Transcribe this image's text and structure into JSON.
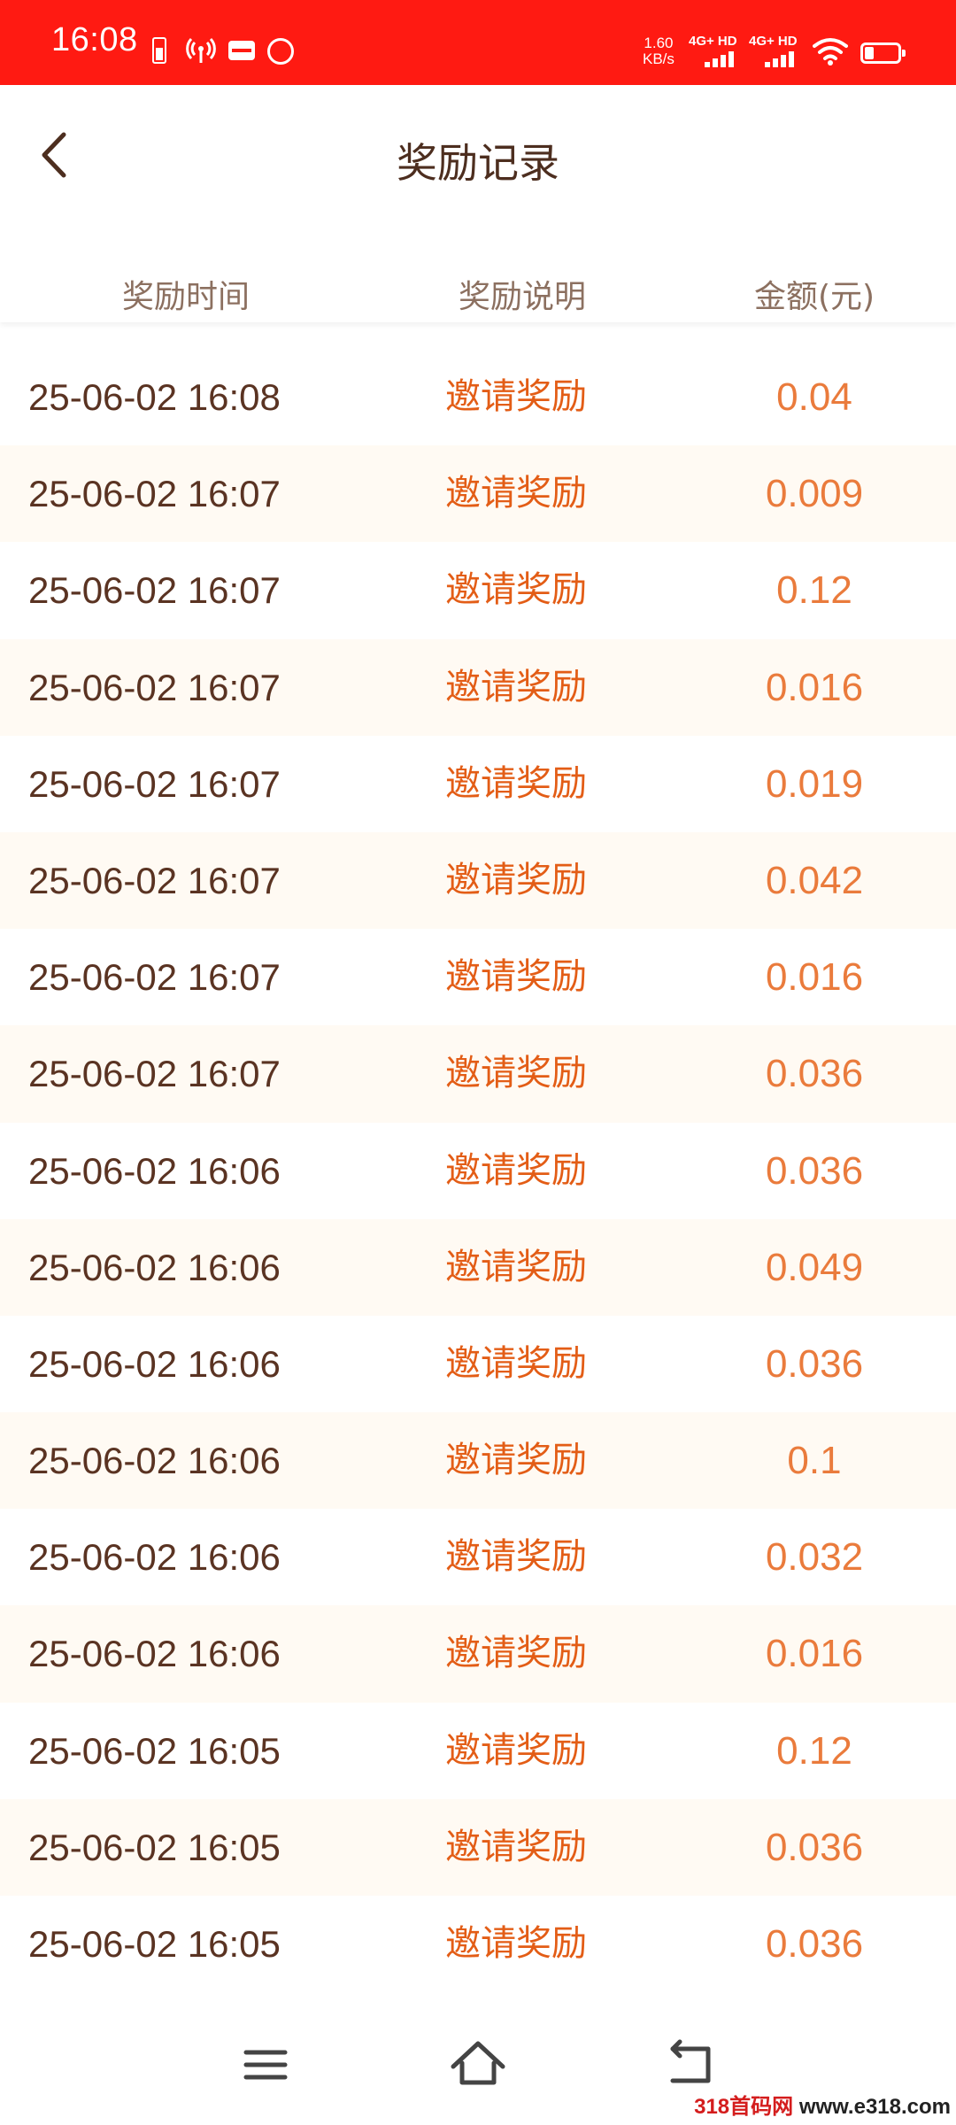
{
  "status_bar": {
    "time": "16:08",
    "speed_value": "1.60",
    "speed_unit": "KB/s",
    "network_1": "4G+ HD",
    "network_2": "4G+ HD",
    "icons": [
      "battery-saver-icon",
      "hotspot-icon",
      "app-notification-icon",
      "app-notification-icon",
      "signal-icon",
      "wifi-icon",
      "battery-icon"
    ]
  },
  "header": {
    "title": "奖励记录",
    "back_icon": "chevron-left-icon"
  },
  "table": {
    "columns": [
      "奖励时间",
      "奖励说明",
      "金额(元)"
    ],
    "rows": [
      {
        "time": "25-06-02 16:08",
        "desc": "邀请奖励",
        "amount": "0.04"
      },
      {
        "time": "25-06-02 16:07",
        "desc": "邀请奖励",
        "amount": "0.009"
      },
      {
        "time": "25-06-02 16:07",
        "desc": "邀请奖励",
        "amount": "0.12"
      },
      {
        "time": "25-06-02 16:07",
        "desc": "邀请奖励",
        "amount": "0.016"
      },
      {
        "time": "25-06-02 16:07",
        "desc": "邀请奖励",
        "amount": "0.019"
      },
      {
        "time": "25-06-02 16:07",
        "desc": "邀请奖励",
        "amount": "0.042"
      },
      {
        "time": "25-06-02 16:07",
        "desc": "邀请奖励",
        "amount": "0.016"
      },
      {
        "time": "25-06-02 16:07",
        "desc": "邀请奖励",
        "amount": "0.036"
      },
      {
        "time": "25-06-02 16:06",
        "desc": "邀请奖励",
        "amount": "0.036"
      },
      {
        "time": "25-06-02 16:06",
        "desc": "邀请奖励",
        "amount": "0.049"
      },
      {
        "time": "25-06-02 16:06",
        "desc": "邀请奖励",
        "amount": "0.036"
      },
      {
        "time": "25-06-02 16:06",
        "desc": "邀请奖励",
        "amount": "0.1"
      },
      {
        "time": "25-06-02 16:06",
        "desc": "邀请奖励",
        "amount": "0.032"
      },
      {
        "time": "25-06-02 16:06",
        "desc": "邀请奖励",
        "amount": "0.016"
      },
      {
        "time": "25-06-02 16:05",
        "desc": "邀请奖励",
        "amount": "0.12"
      },
      {
        "time": "25-06-02 16:05",
        "desc": "邀请奖励",
        "amount": "0.036"
      },
      {
        "time": "25-06-02 16:05",
        "desc": "邀请奖励",
        "amount": "0.036"
      }
    ]
  },
  "nav_bar": {
    "icons": [
      "menu-icon",
      "home-icon",
      "back-icon"
    ]
  },
  "watermark": {
    "part1": "318首码网 ",
    "part2": "www.e318.com"
  },
  "colors": {
    "status_bar_bg": "#ff1a12",
    "title_text": "#4d2e1f",
    "column_header_text": "#8c7060",
    "time_text": "#5a3322",
    "desc_text": "#e35d16",
    "amount_text": "#ea7b3c",
    "alt_row_bg": "#fffaf3"
  }
}
